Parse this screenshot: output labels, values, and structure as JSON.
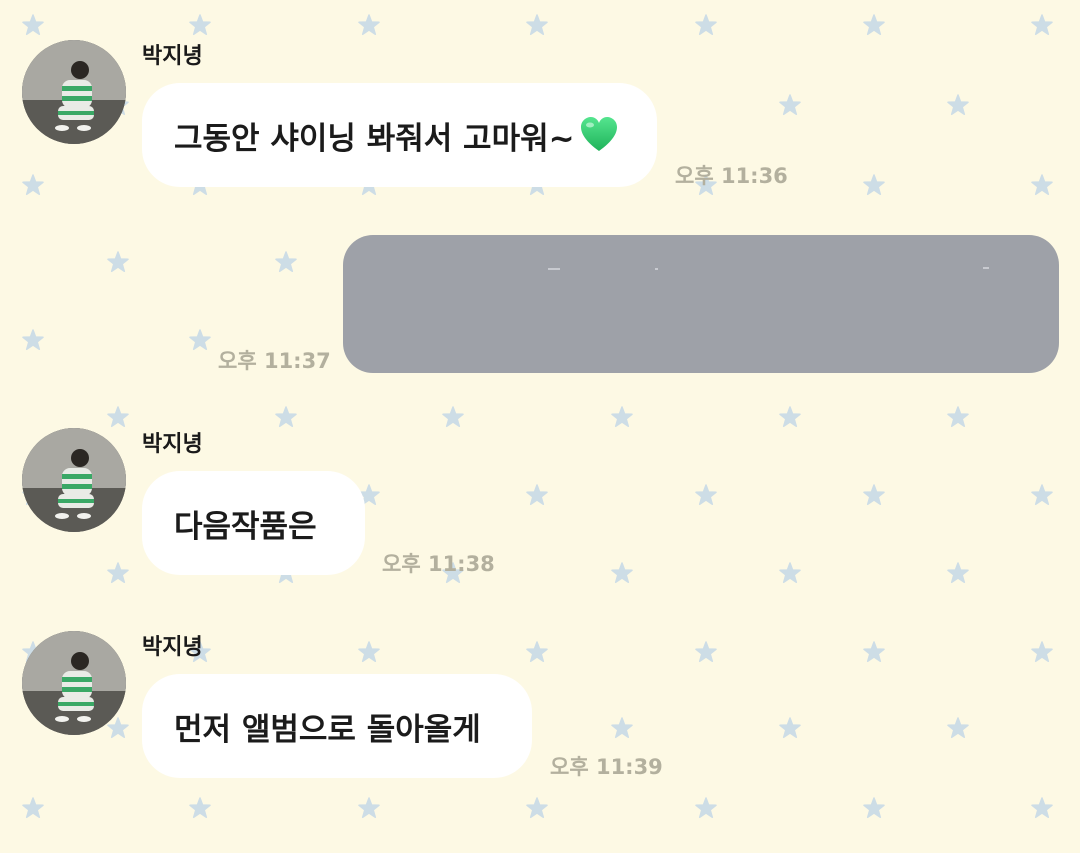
{
  "chat": {
    "messages": [
      {
        "sender": "박지녕",
        "text": "그동안 샤이닝 봐줘서 고마워~",
        "emoji": "green-heart",
        "time": "오후 11:36"
      },
      {
        "sender": "",
        "text": "",
        "time": "오후 11:37",
        "outgoing": true
      },
      {
        "sender": "박지녕",
        "text": "다음작품은",
        "time": "오후 11:38"
      },
      {
        "sender": "박지녕",
        "text": "먼저 앨범으로 돌아올게",
        "time": "오후 11:39"
      }
    ]
  },
  "theme": {
    "background": "#fdf9e4",
    "star_color": "#cddde6",
    "incoming_bubble": "#ffffff",
    "outgoing_bubble": "#9ea1a8",
    "timestamp_color": "#b3b09e",
    "heart_color": "#2ecf73"
  }
}
